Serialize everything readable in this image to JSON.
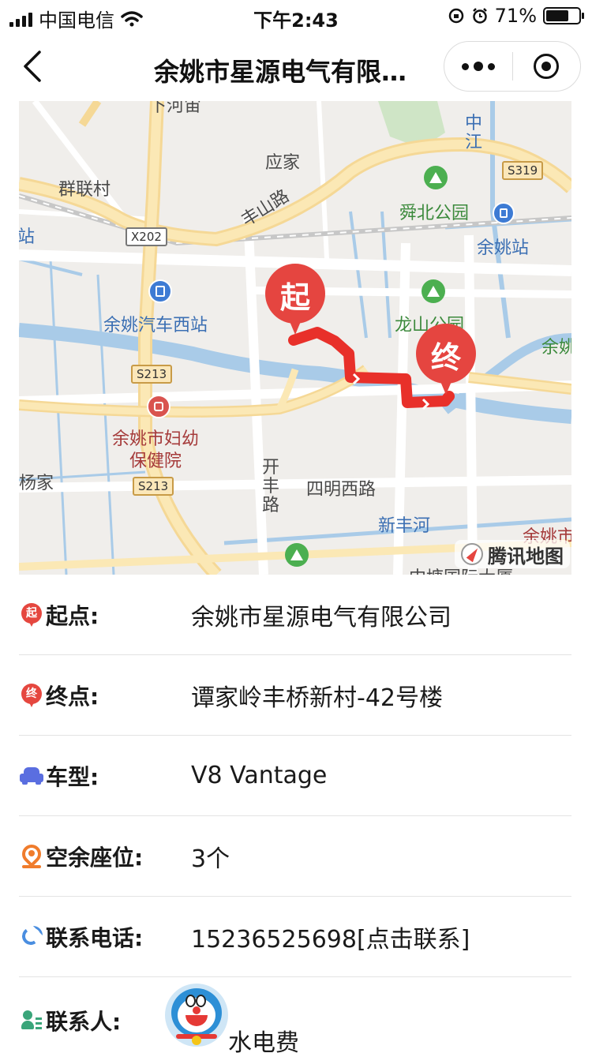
{
  "status_bar": {
    "carrier": "中国电信",
    "time": "下午2:43",
    "battery": "71%",
    "battery_level": 0.71
  },
  "nav": {
    "title": "余姚市星源电气有限…",
    "back_icon": "chevron-left-icon",
    "more_icon": "more-dots-icon",
    "close_icon": "target-close-icon"
  },
  "map": {
    "start_pin": "起",
    "end_pin": "终",
    "attribution": "腾讯地图",
    "labels": {
      "yingjia": "应家",
      "qunlian": "群联村",
      "fengshan_road": "丰山路",
      "x202": "X202",
      "s319": "S319",
      "shunbei_park": "舜北公园",
      "yuyao_station": "余姚站",
      "zhan_left": "站",
      "zhong": "中",
      "jiang": "江",
      "bus_station": "余姚汽车西站",
      "longshan_park": "龙山公园",
      "yuyao_right": "余姚",
      "s213_a": "S213",
      "s213_b": "S213",
      "hospital_line1": "余姚市妇幼",
      "hospital_line2": "保健院",
      "yangjia": "杨家",
      "kai": "开",
      "feng": "丰",
      "lu": "路",
      "siming_road": "四明西路",
      "xinfeng_river": "新丰河",
      "yuyao_city": "余姚市",
      "top_cut": "下河宙",
      "bottom_cut": "中塘国际大厦"
    }
  },
  "info": {
    "start": {
      "label": "起点:",
      "value": "余姚市星源电气有限公司",
      "icon_text": "起"
    },
    "end": {
      "label": "终点:",
      "value": "谭家岭丰桥新村-42号楼",
      "icon_text": "终"
    },
    "car": {
      "label": "车型:",
      "value": "V8 Vantage"
    },
    "seats": {
      "label": "空余座位:",
      "value": "3个"
    },
    "phone": {
      "label": "联系电话:",
      "value": "15236525698[点击联系]"
    },
    "contact": {
      "label": "联系人:",
      "value": "水电费"
    }
  },
  "colors": {
    "pin_red": "#e54540",
    "route_red": "#e8302a",
    "car_icon": "#5a6ee0",
    "seat_icon": "#f07c2c",
    "phone_icon": "#4a8ee0",
    "contact_icon": "#3aa57a"
  }
}
